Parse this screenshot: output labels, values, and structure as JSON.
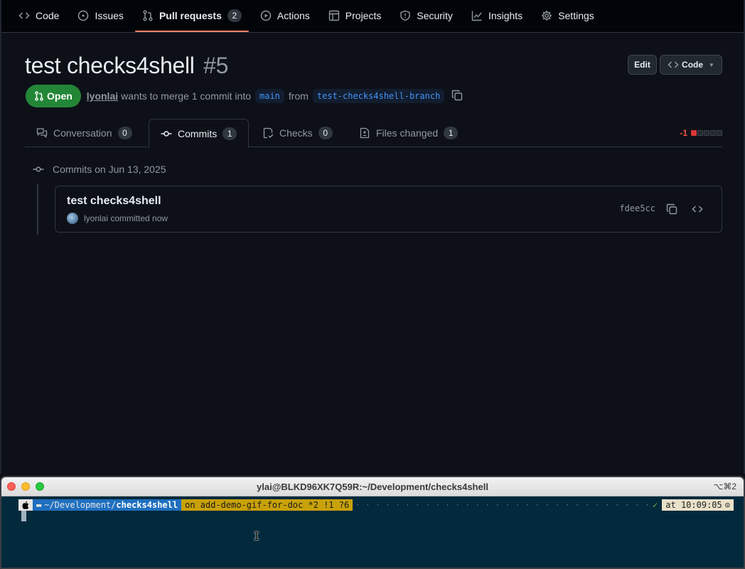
{
  "repo_nav": {
    "items": [
      {
        "label": "Code",
        "icon": "code-icon"
      },
      {
        "label": "Issues",
        "icon": "issue-opened-icon"
      },
      {
        "label": "Pull requests",
        "icon": "git-pull-request-icon",
        "count": "2"
      },
      {
        "label": "Actions",
        "icon": "play-icon"
      },
      {
        "label": "Projects",
        "icon": "table-icon"
      },
      {
        "label": "Security",
        "icon": "shield-icon"
      },
      {
        "label": "Insights",
        "icon": "graph-icon"
      },
      {
        "label": "Settings",
        "icon": "gear-icon"
      }
    ]
  },
  "pr": {
    "title": "test checks4shell",
    "number": "#5",
    "edit_label": "Edit",
    "code_label": "Code",
    "state": "Open",
    "author": "lyonlai",
    "merge_text": "wants to merge 1 commit into",
    "base_branch": "main",
    "from_text": "from",
    "head_branch": "test-checks4shell-branch"
  },
  "tabs": [
    {
      "label": "Conversation",
      "count": "0",
      "icon": "comment-discussion-icon"
    },
    {
      "label": "Commits",
      "count": "1",
      "icon": "git-commit-icon"
    },
    {
      "label": "Checks",
      "count": "0",
      "icon": "checklist-icon"
    },
    {
      "label": "Files changed",
      "count": "1",
      "icon": "file-diff-icon"
    }
  ],
  "diffstat": {
    "deletions": "-1"
  },
  "commits": {
    "heading": "Commits on Jun 13, 2025",
    "items": [
      {
        "title": "test checks4shell",
        "meta": "lyonlai committed now",
        "sha": "fdee5cc"
      }
    ]
  },
  "terminal": {
    "title": "ylai@BLKD96XK7Q59R:~/Development/checks4shell",
    "shortcut": "⌥⌘2",
    "dir_prefix": "~/Development/",
    "dir_name": "checks4shell",
    "git": "on  add-demo-gif-for-doc *2 !1 ?6",
    "status_mark": "✓",
    "time": "at 10:09:05"
  },
  "colors": {
    "accent": "#f78166",
    "open": "#238636",
    "link": "#4493f8",
    "danger": "#f85149"
  }
}
